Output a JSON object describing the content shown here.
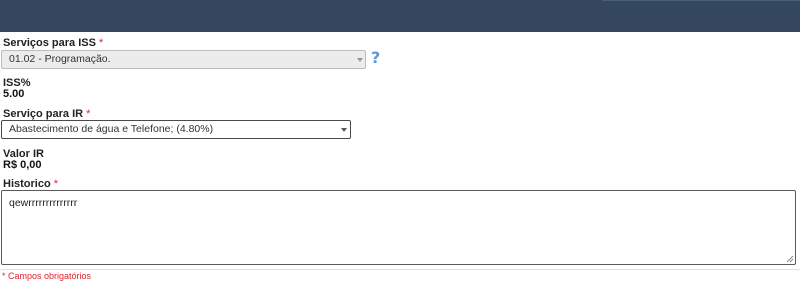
{
  "form": {
    "servicos_iss": {
      "label": "Serviços para ISS",
      "required_mark": "*",
      "selected": "01.02 - Programação."
    },
    "help": "?",
    "iss": {
      "label": "ISS%",
      "value": "5.00"
    },
    "servico_ir": {
      "label": "Serviço para IR",
      "required_mark": "*",
      "selected": "Abastecimento de água e Telefone; (4.80%)"
    },
    "valor_ir": {
      "label": "Valor IR",
      "value": "R$ 0,00"
    },
    "historico": {
      "label": "Historico",
      "required_mark": "*",
      "value": "qewrrrrrrrrrrrrrr"
    },
    "required_note": {
      "mark": "*",
      "text": " Campos obrigatórios"
    }
  },
  "colors": {
    "header": "#34475e",
    "required": "#e0232e",
    "help_icon": "#5b9bd5"
  }
}
